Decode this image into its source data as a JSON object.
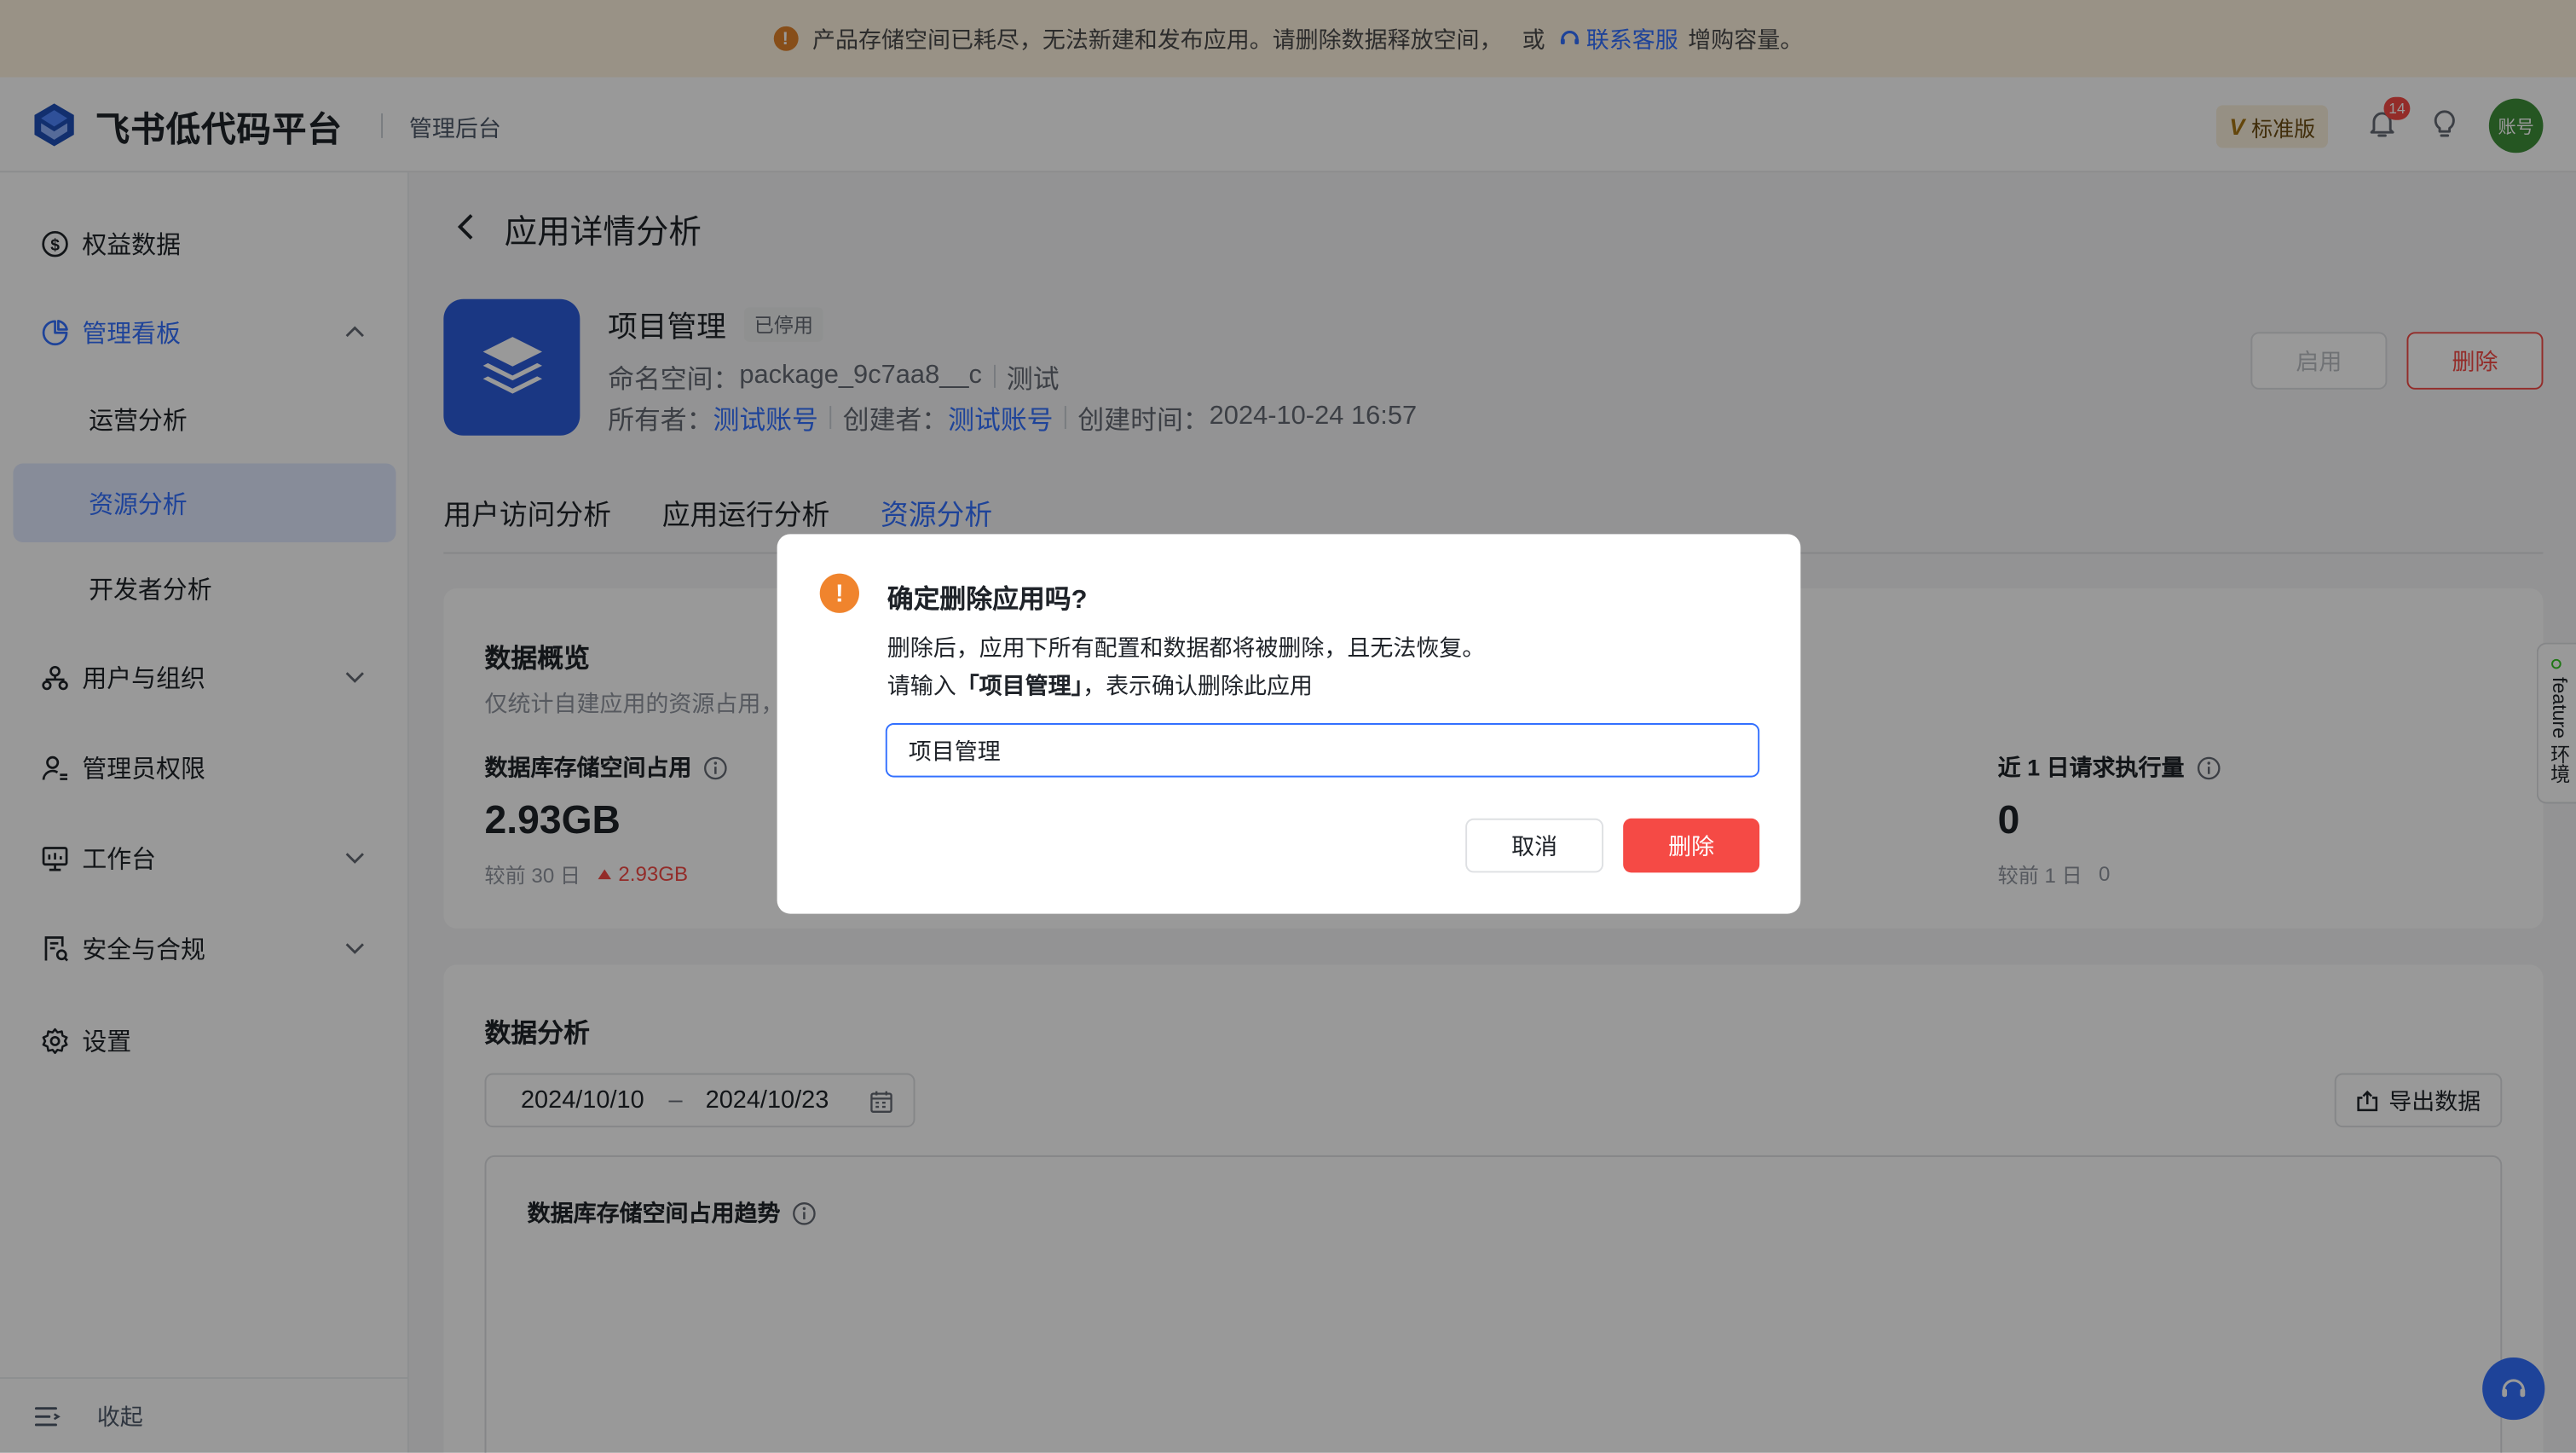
{
  "banner": {
    "message": "产品存储空间已耗尽，无法新建和发布应用。请删除数据释放空间，",
    "or": "或",
    "link": "联系客服",
    "tail": "增购容量。"
  },
  "header": {
    "brand": "飞书低代码平台",
    "console": "管理后台",
    "plan_mark": "V",
    "plan_label": "标准版",
    "notification_count": "14",
    "avatar_label": "账号"
  },
  "sidebar": {
    "items": [
      {
        "label": "权益数据"
      },
      {
        "label": "管理看板"
      },
      {
        "label": "运营分析"
      },
      {
        "label": "资源分析"
      },
      {
        "label": "开发者分析"
      },
      {
        "label": "用户与组织"
      },
      {
        "label": "管理员权限"
      },
      {
        "label": "工作台"
      },
      {
        "label": "安全与合规"
      },
      {
        "label": "设置"
      }
    ],
    "collapse": "收起"
  },
  "page": {
    "title": "应用详情分析",
    "app_name": "项目管理",
    "app_status": "已停用",
    "namespace_label": "命名空间：",
    "namespace_value": "package_9c7aa8__c",
    "env": "测试",
    "owner_label": "所有者：",
    "owner": "测试账号",
    "creator_label": "创建者：",
    "creator": "测试账号",
    "created_label": "创建时间：",
    "created_time": "2024-10-24 16:57",
    "enable_button": "启用",
    "delete_button": "删除"
  },
  "tabs": [
    {
      "label": "用户访问分析"
    },
    {
      "label": "应用运行分析"
    },
    {
      "label": "资源分析"
    }
  ],
  "overview": {
    "title": "数据概览",
    "desc": "仅统计自建应用的资源占用，",
    "metric1": {
      "label": "数据库存储空间占用",
      "value": "2.93GB",
      "compare": "较前 30 日",
      "delta": "2.93GB"
    },
    "metric2": {
      "label": "近 1 日请求执行量",
      "value": "0",
      "compare": "较前 1 日",
      "delta": "0"
    }
  },
  "analysis": {
    "title": "数据分析",
    "date_start": "2024/10/10",
    "date_sep": "–",
    "date_end": "2024/10/23",
    "export": "导出数据",
    "chart_title": "数据库存储空间占用趋势"
  },
  "side_tab": {
    "label": "feature 环境"
  },
  "modal": {
    "title": "确定删除应用吗?",
    "body1": "删除后，应用下所有配置和数据都将被删除，且无法恢复。",
    "body2_prefix": "请输入",
    "body2_name": "「项目管理」",
    "body2_suffix": "，表示确认删除此应用",
    "input_value": "项目管理",
    "cancel": "取消",
    "confirm": "删除"
  },
  "colors": {
    "accent": "#3370ff",
    "danger": "#f54a45",
    "warning": "#f0842d"
  }
}
